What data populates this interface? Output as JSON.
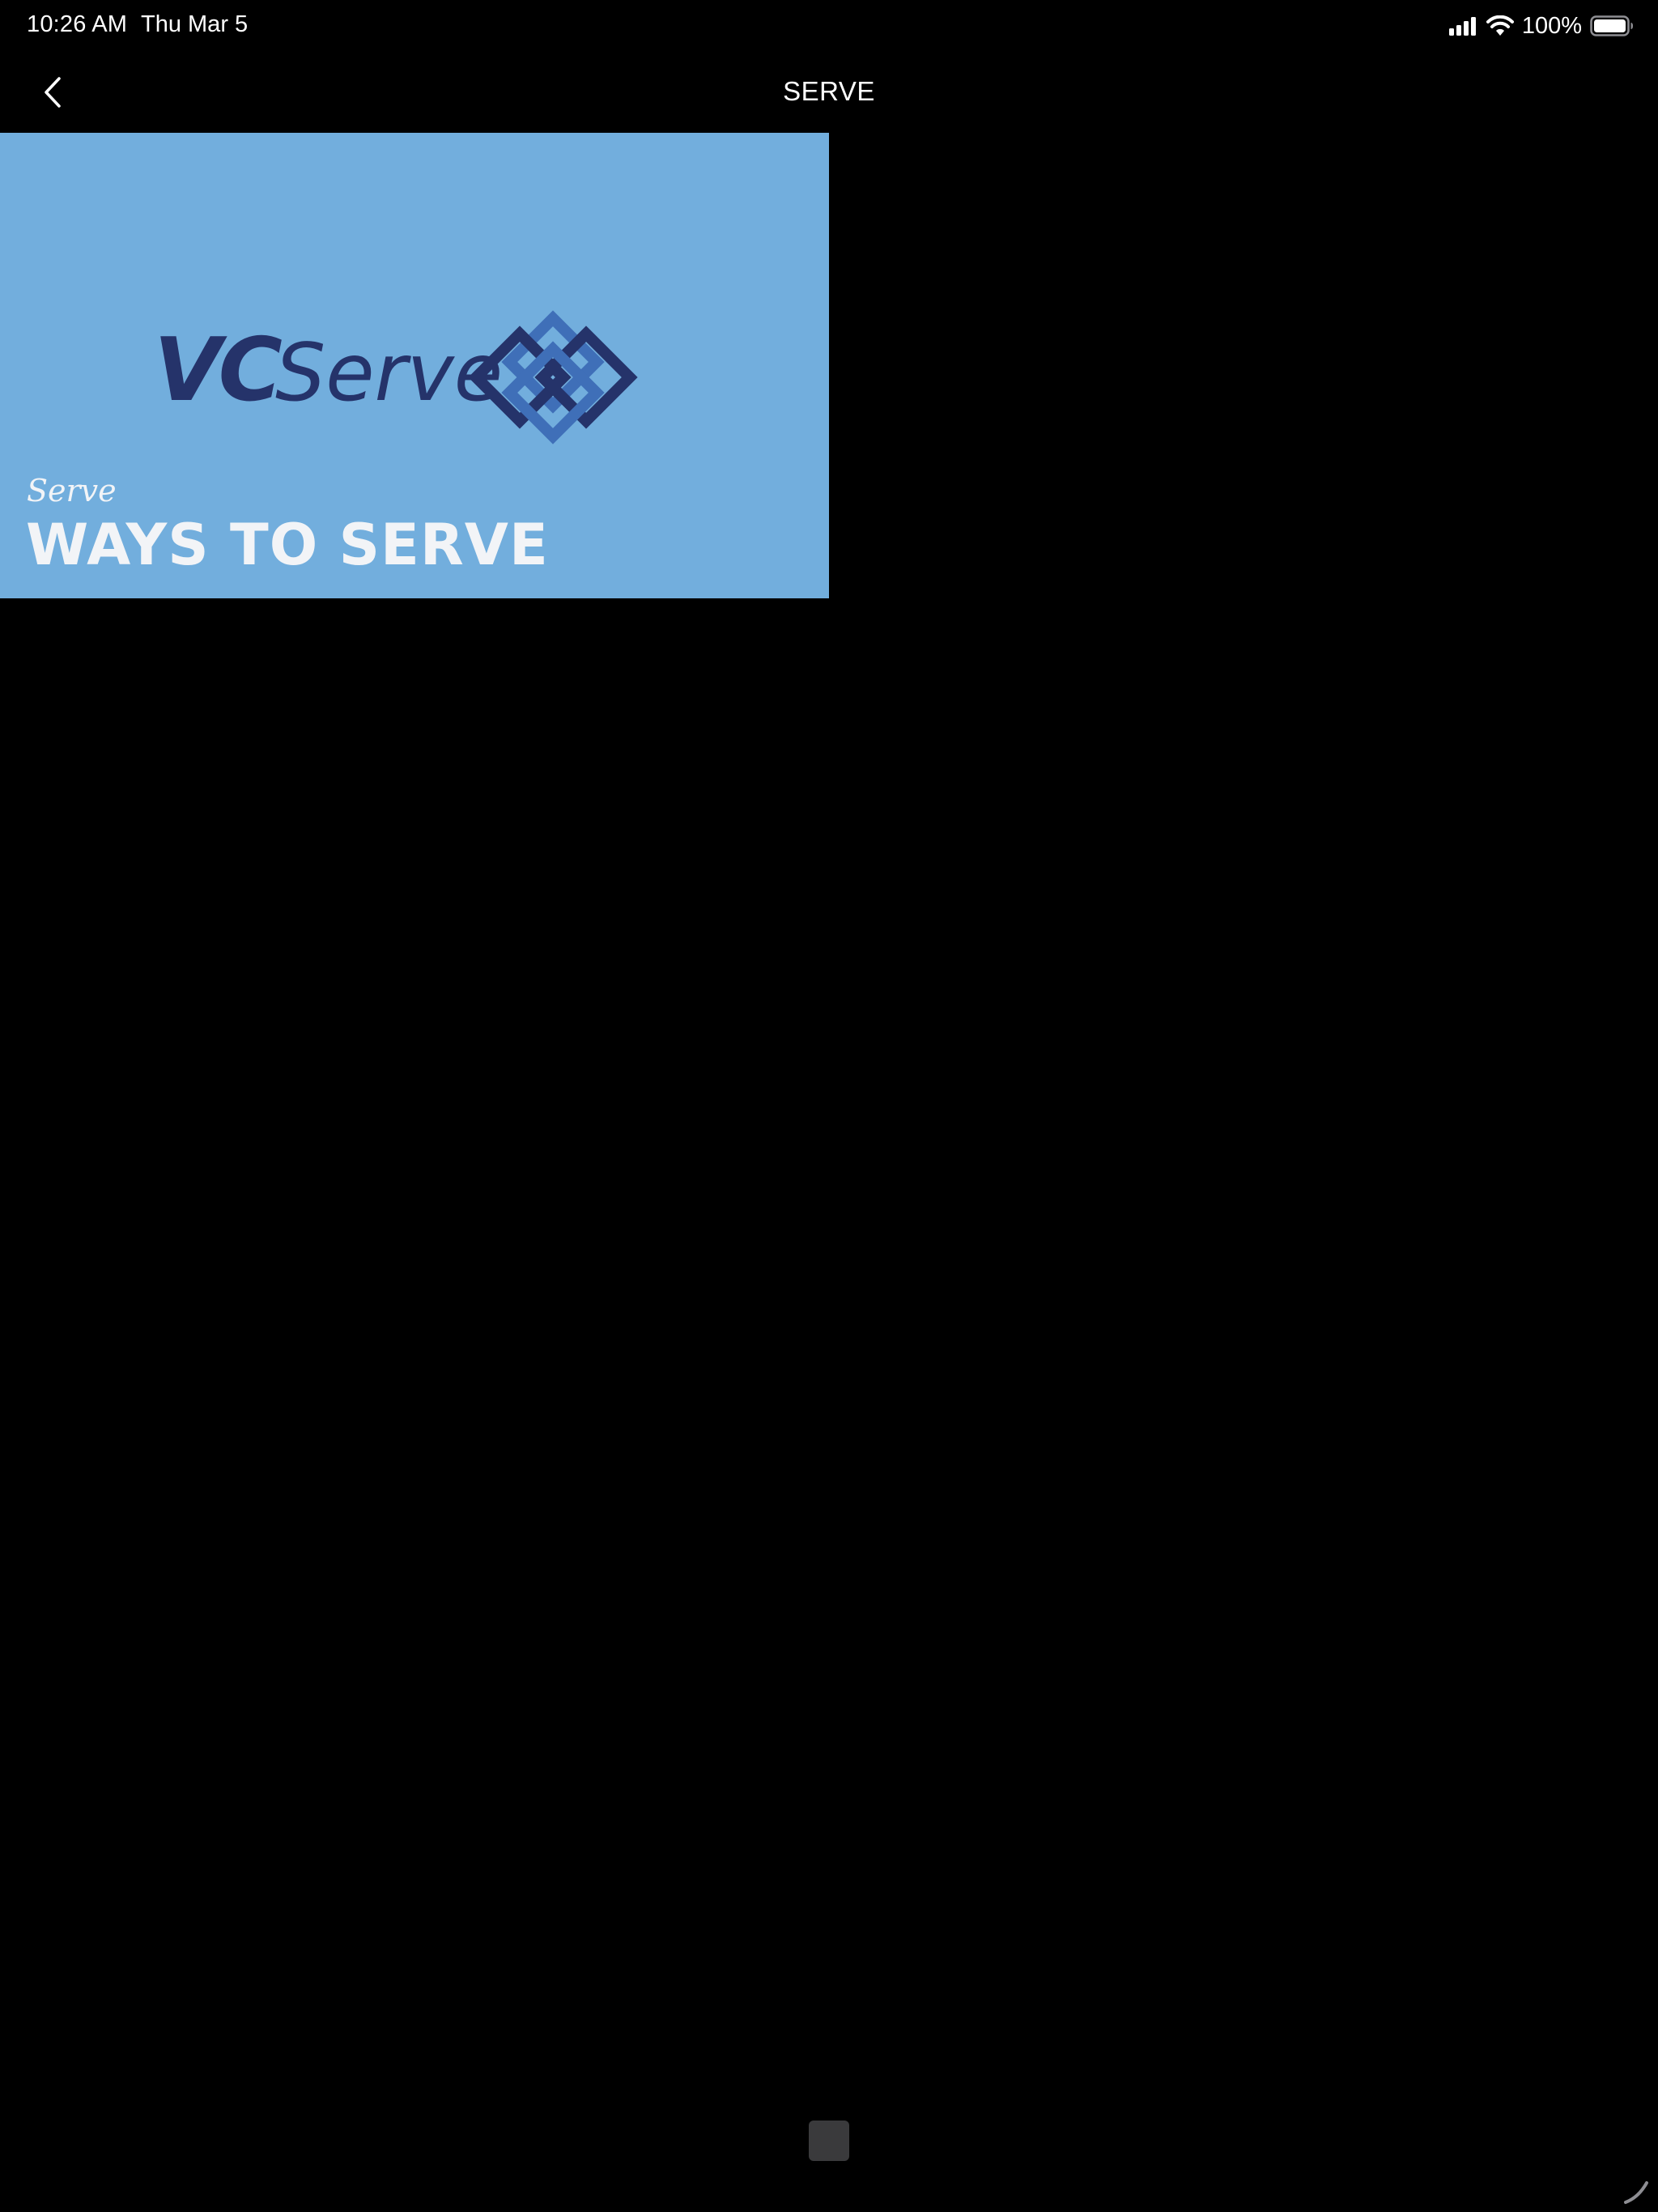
{
  "status_bar": {
    "time": "10:26 AM",
    "date": "Thu Mar 5",
    "battery_percent": "100%",
    "icons": [
      "cellular-signal-icon",
      "wifi-icon",
      "battery-icon"
    ]
  },
  "nav": {
    "title": "SERVE",
    "back_icon": "chevron-left-icon"
  },
  "banner": {
    "logo_text_bold": "VC",
    "logo_text": "Serve",
    "eyebrow": "Serve",
    "title": "WAYS TO SERVE",
    "colors": {
      "background": "#72aedd",
      "logo_dark": "#25336a",
      "logo_mid": "#3f6fb8",
      "text": "#f2f4f7"
    }
  }
}
